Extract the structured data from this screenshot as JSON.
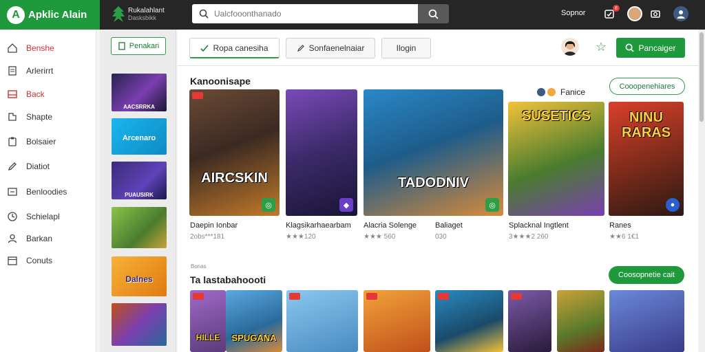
{
  "brand": {
    "name": "Apklic Alain",
    "logo_glyph": "A"
  },
  "store": {
    "title": "Rukalahlant",
    "subtitle": "Dasksbikk"
  },
  "search": {
    "placeholder": "Ualcfooonthanado"
  },
  "top_actions": {
    "link": "Sopnor",
    "badge": "8"
  },
  "sidebar": {
    "items": [
      {
        "label": "Benshe",
        "icon": "home-icon",
        "active": true
      },
      {
        "label": "Arlerirrt",
        "icon": "document-icon"
      },
      {
        "label": "Back",
        "icon": "inbox-icon",
        "active": true
      },
      {
        "label": "Shapte",
        "icon": "puzzle-icon"
      },
      {
        "label": "Bolsaier",
        "icon": "clipboard-icon"
      },
      {
        "label": "Diatiot",
        "icon": "pencil-icon"
      },
      {
        "label": "Benloodies",
        "icon": "chart-icon"
      },
      {
        "label": "Schielapl",
        "icon": "clock-icon"
      },
      {
        "label": "Barkan",
        "icon": "user-icon"
      },
      {
        "label": "Conuts",
        "icon": "calendar-icon"
      }
    ]
  },
  "thumb_column": {
    "button_label": "Penakari",
    "thumbs": [
      {
        "label": "AACSRRKA",
        "color": "#2a2350"
      },
      {
        "label": "Arcenaro",
        "color": "#16a6dd"
      },
      {
        "label": "PUAUSIRK",
        "color": "#3b2a7a"
      },
      {
        "label": "",
        "color": "#6aa93c"
      },
      {
        "label": "Dalnes",
        "color": "#f39a1e"
      },
      {
        "label": "",
        "color": "#7a3fb0"
      }
    ]
  },
  "tabs": [
    {
      "label": "Ropa canesiha",
      "icon": "check-icon",
      "active": true
    },
    {
      "label": "Sonfaenelnaiar",
      "icon": "pencil-icon"
    },
    {
      "label": "Ilogin",
      "icon": ""
    }
  ],
  "main_action": {
    "label": "Pancaiger"
  },
  "section1": {
    "title": "Kanoonisape",
    "sub_label": "Fanice",
    "action": "Cooopenehiares",
    "cards": [
      {
        "art": "AIRCSKIN",
        "title": "Daepin Ionbar",
        "rating": "2obs***181",
        "color": "#3b2a22",
        "chip": "#2e9e46"
      },
      {
        "art": "",
        "title": "Klagsikarhaearbam",
        "rating": "★★★120",
        "color": "#3a2a68",
        "chip": "#6a3fc7"
      },
      {
        "art": "TADODNIV",
        "title": "Alacria Solenge",
        "rating": "★★★ 560",
        "color": "#1e5c8a",
        "chip": "#2e9e46"
      },
      {
        "art": "",
        "title": "Baliaget",
        "rating": "030",
        "color": "#1e5c8a",
        "chip": ""
      },
      {
        "art": "SUSETICS",
        "title": "Splacknal Ingtlent",
        "rating": "3★★★2 260",
        "color": "#4a7c2e",
        "chip": ""
      },
      {
        "art": "NINU RARAS",
        "title": "Ranes",
        "rating": "★★6 1€1",
        "color": "#7a2a1a",
        "chip": "#2a5fd0"
      }
    ]
  },
  "section2": {
    "eyebrow": "Bonas",
    "title": "Ta lastabahoooti",
    "action": "Coosopnetie cait",
    "cards": [
      {
        "art": "HILLE",
        "color": "#5a3a7a"
      },
      {
        "art": "SPUGANA",
        "color": "#2a6a9a"
      },
      {
        "art": "",
        "color": "#4a8ac0"
      },
      {
        "art": "",
        "color": "#c0501a"
      },
      {
        "art": "",
        "color": "#1a4a6a"
      },
      {
        "art": "",
        "color": "#2a1a3a"
      },
      {
        "art": "",
        "color": "#5a7a2a"
      },
      {
        "art": "",
        "color": "#3a3a8a"
      }
    ]
  }
}
